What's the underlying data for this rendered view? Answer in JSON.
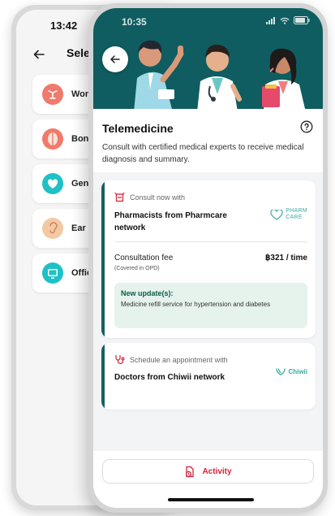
{
  "back_screen": {
    "time": "13:42",
    "title": "Selec",
    "items": [
      {
        "label": "Wom",
        "icon": "uterus-icon",
        "color": "#f07a6b"
      },
      {
        "label": "Bone",
        "icon": "bone-joint-icon",
        "color": "#f07a6b"
      },
      {
        "label": "Gene",
        "icon": "heart-icon",
        "color": "#1ec1c5"
      },
      {
        "label": "Ear N",
        "icon": "ear-icon",
        "color": "#f3c9a3"
      },
      {
        "label": "Offic",
        "icon": "monitor-icon",
        "color": "#1ec1c5"
      }
    ]
  },
  "front_screen": {
    "time": "10:35",
    "title": "Telemedicine",
    "description": "Consult with certified medical experts to receive medical diagnosis and summary.",
    "consult_card": {
      "header": "Consult now with",
      "provider": "Pharmacists from Pharmcare network",
      "partner_logo_line1": "PHARM",
      "partner_logo_line2": "CARE",
      "fee_label": "Consultation fee",
      "fee_note": "(Covered in OPD)",
      "fee_value": "฿321 / time",
      "update_title": "New update(s):",
      "update_text": "Medicine refill service for hypertension and diabetes"
    },
    "schedule_card": {
      "header": "Schedule an appointment with",
      "provider": "Doctors from Chiwii network",
      "partner_logo": "Chiwii"
    },
    "activity_button": "Activity"
  },
  "colors": {
    "hero_bg": "#0f5d60",
    "accent_teal": "#135f63",
    "accent_red": "#d51f36",
    "update_bg": "#e6f2ec"
  }
}
